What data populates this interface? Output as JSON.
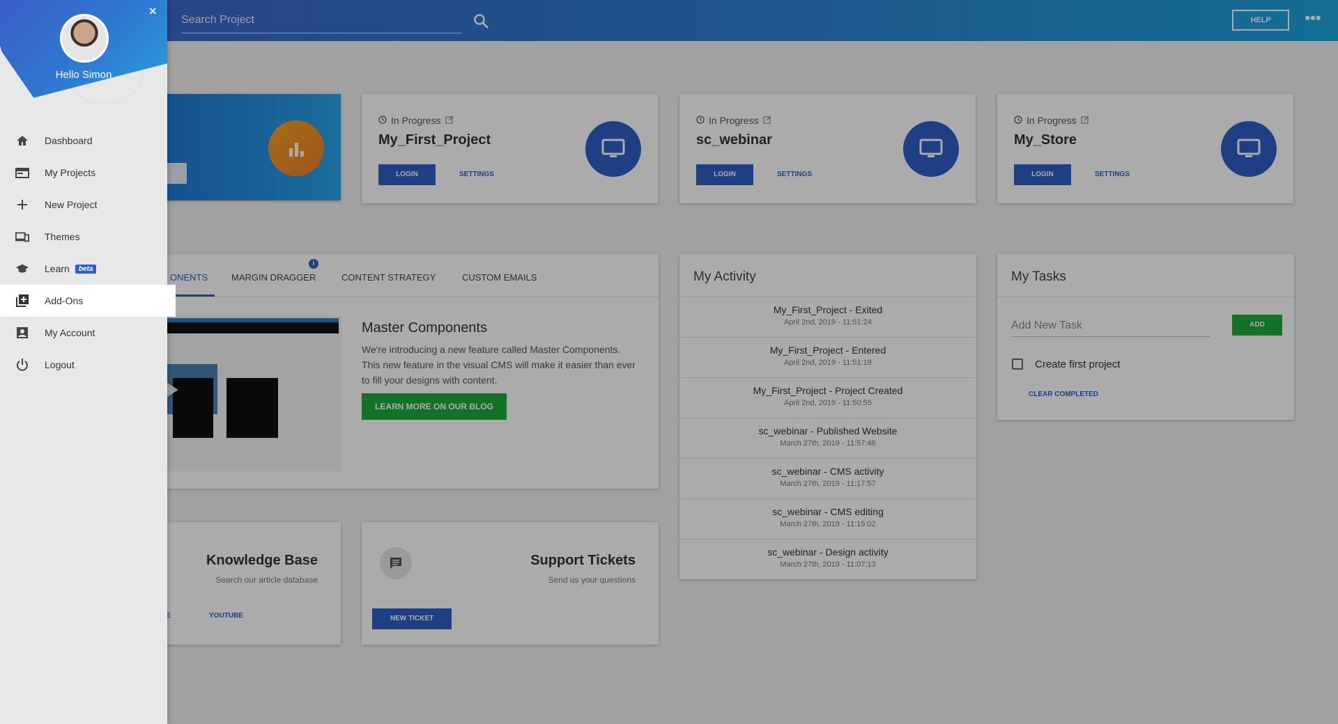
{
  "topbar": {
    "search_placeholder": "Search Project",
    "help_label": "HELP",
    "more_label": "•••"
  },
  "projects": [
    {
      "status": "In Progress",
      "name": "My_First_Project",
      "login": "LOGIN",
      "settings": "SETTINGS"
    },
    {
      "status": "In Progress",
      "name": "sc_webinar",
      "login": "LOGIN",
      "settings": "SETTINGS"
    },
    {
      "status": "In Progress",
      "name": "My_Store",
      "login": "LOGIN",
      "settings": "SETTINGS"
    }
  ],
  "feature": {
    "tabs": [
      "ONENTS",
      "MARGIN DRAGGER",
      "CONTENT STRATEGY",
      "CUSTOM EMAILS"
    ],
    "info_badge": "i",
    "title": "Master Components",
    "text": "We're introducing a new feature called Master Components. This new feature in the visual CMS will make it easier than ever to fill your designs with content.",
    "button": "LEARN MORE ON OUR BLOG"
  },
  "knowledge_base": {
    "title": "Knowledge Base",
    "subtitle": "Search our article database",
    "link_partial": "E",
    "youtube": "YOUTUBE"
  },
  "support": {
    "title": "Support Tickets",
    "subtitle": "Send us your questions",
    "button": "NEW TICKET"
  },
  "activity": {
    "title": "My Activity",
    "items": [
      {
        "title": "My_First_Project - Exited",
        "time": "April 2nd, 2019 - 11:51:24"
      },
      {
        "title": "My_First_Project - Entered",
        "time": "April 2nd, 2019 - 11:51:18"
      },
      {
        "title": "My_First_Project - Project Created",
        "time": "April 2nd, 2019 - 11:50:55"
      },
      {
        "title": "sc_webinar - Published Website",
        "time": "March 27th, 2019 - 11:57:46"
      },
      {
        "title": "sc_webinar - CMS activity",
        "time": "March 27th, 2019 - 11:17:57"
      },
      {
        "title": "sc_webinar - CMS editing",
        "time": "March 27th, 2019 - 11:15:02"
      },
      {
        "title": "sc_webinar - Design activity",
        "time": "March 27th, 2019 - 11:07:13"
      }
    ]
  },
  "tasks": {
    "title": "My Tasks",
    "input_placeholder": "Add New Task",
    "add": "ADD",
    "item": "Create first project",
    "clear": "CLEAR COMPLETED"
  },
  "sidebar": {
    "greeting": "Hello Simon",
    "close": "×",
    "items": [
      {
        "label": "Dashboard",
        "icon": "home-icon"
      },
      {
        "label": "My Projects",
        "icon": "projects-icon"
      },
      {
        "label": "New Project",
        "icon": "plus-icon"
      },
      {
        "label": "Themes",
        "icon": "devices-icon"
      },
      {
        "label": "Learn",
        "icon": "school-icon",
        "badge": "beta"
      },
      {
        "label": "Add-Ons",
        "icon": "library-add-icon",
        "active": true
      },
      {
        "label": "My Account",
        "icon": "account-box-icon"
      },
      {
        "label": "Logout",
        "icon": "power-icon"
      }
    ]
  },
  "colors": {
    "primary": "#2d5fc5",
    "success": "#1faa3b",
    "accent_orange": "#f5a623"
  }
}
